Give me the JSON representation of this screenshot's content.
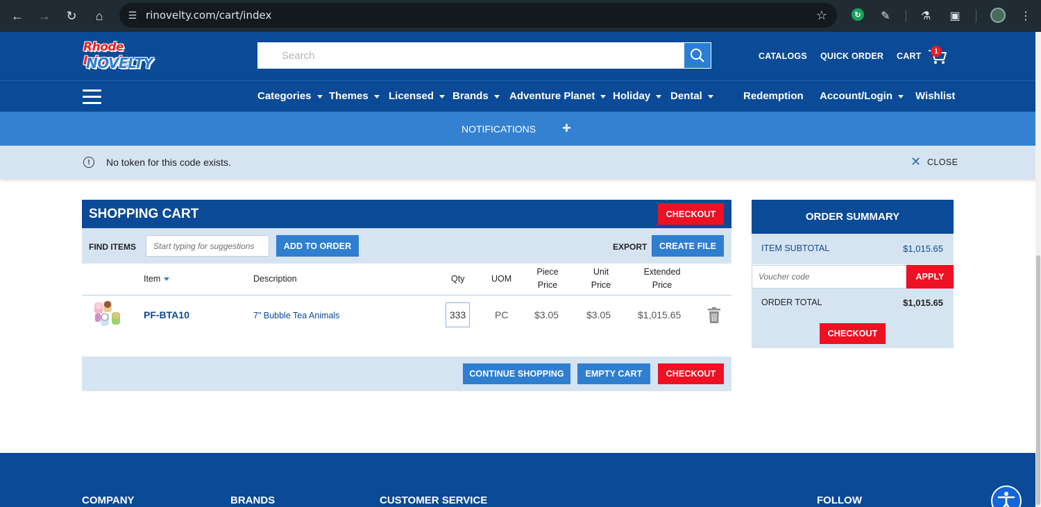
{
  "browser": {
    "url": "rinovelty.com/cart/index"
  },
  "site": {
    "logo_line1": "Rhode Island",
    "logo_line2": "NOVELTY",
    "search_placeholder": "Search",
    "top_links": {
      "catalogs": "CATALOGS",
      "quick_order": "QUICK ORDER",
      "cart": "CART"
    },
    "cart_count": "1"
  },
  "nav": {
    "items": [
      {
        "label": "Categories",
        "dropdown": true
      },
      {
        "label": "Themes",
        "dropdown": true
      },
      {
        "label": "Licensed",
        "dropdown": true
      },
      {
        "label": "Brands",
        "dropdown": true
      },
      {
        "label": "Adventure Planet",
        "dropdown": true
      },
      {
        "label": "Holiday",
        "dropdown": true
      },
      {
        "label": "Dental",
        "dropdown": true
      },
      {
        "label": "Redemption",
        "dropdown": false
      },
      {
        "label": "Account/Login",
        "dropdown": true
      },
      {
        "label": "Wishlist",
        "dropdown": false
      }
    ]
  },
  "notifications": {
    "label": "NOTIFICATIONS",
    "toggle": "+"
  },
  "alert": {
    "message": "No token for this code exists.",
    "close_label": "CLOSE"
  },
  "cart": {
    "title": "SHOPPING CART",
    "checkout_label": "CHECKOUT",
    "find_items_label": "FIND ITEMS",
    "find_items_placeholder": "Start typing for suggestions",
    "add_to_order_label": "ADD TO ORDER",
    "export_label": "EXPORT",
    "create_file_label": "CREATE FILE",
    "columns": {
      "item": "Item",
      "description": "Description",
      "qty": "Qty",
      "uom": "UOM",
      "piece_price_1": "Piece",
      "piece_price_2": "Price",
      "unit_price_1": "Unit",
      "unit_price_2": "Price",
      "extended_price_1": "Extended",
      "extended_price_2": "Price"
    },
    "rows": [
      {
        "sku": "PF-BTA10",
        "description": "7\" Bubble Tea Animals",
        "qty": "333",
        "uom": "PC",
        "piece_price": "$3.05",
        "unit_price": "$3.05",
        "extended_price": "$1,015.65"
      }
    ],
    "continue_shopping_label": "CONTINUE SHOPPING",
    "empty_cart_label": "EMPTY CART"
  },
  "summary": {
    "title": "ORDER SUMMARY",
    "subtotal_label": "ITEM SUBTOTAL",
    "subtotal_value": "$1,015.65",
    "voucher_placeholder": "Voucher code",
    "apply_label": "APPLY",
    "total_label": "ORDER TOTAL",
    "total_value": "$1,015.65",
    "checkout_label": "CHECKOUT"
  },
  "footer": {
    "company": "COMPANY",
    "brands": "BRANDS",
    "customer_service": "CUSTOMER SERVICE",
    "follow": "FOLLOW"
  },
  "colors": {
    "brand_blue": "#0a4a96",
    "accent_blue": "#2f7ed0",
    "light_blue": "#d6e4f2",
    "checkout_red": "#ee1124"
  }
}
